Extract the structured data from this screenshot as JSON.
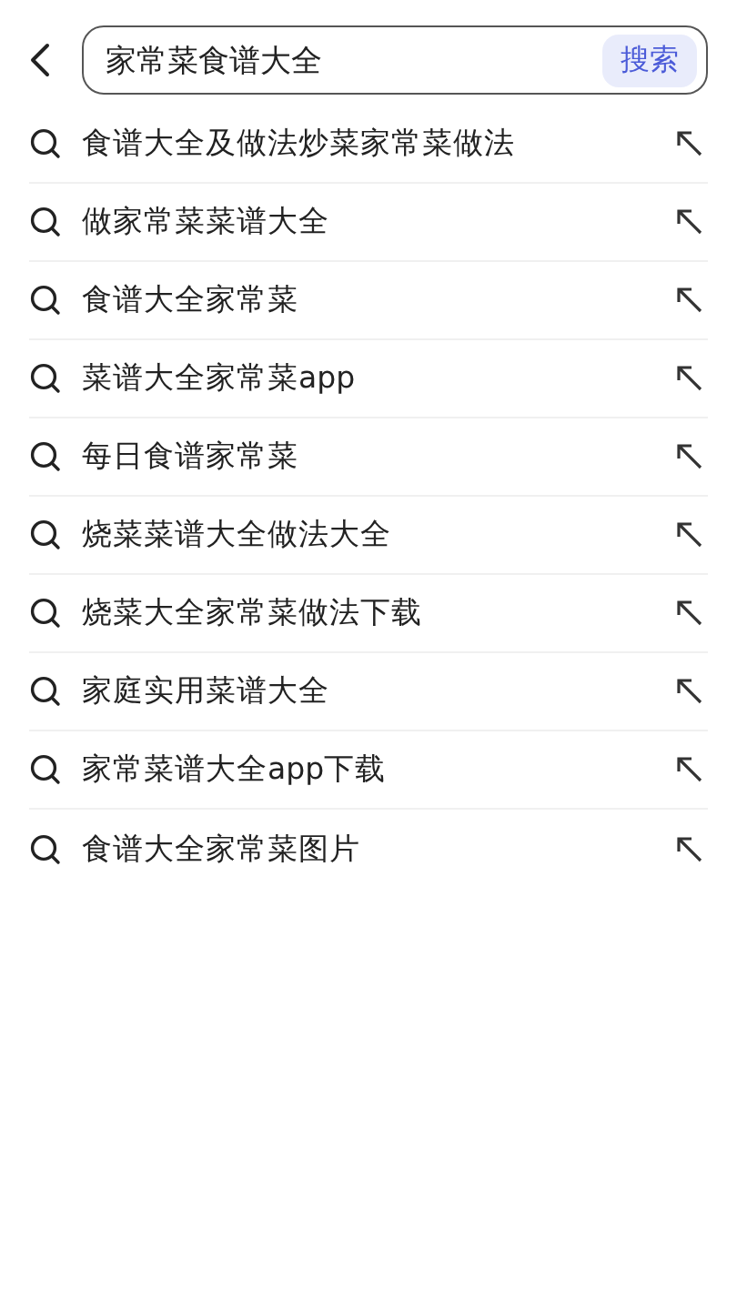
{
  "search": {
    "value": "家常菜食谱大全",
    "button": "搜索"
  },
  "suggestions": [
    {
      "text": "食谱大全及做法炒菜家常菜做法"
    },
    {
      "text": "做家常菜菜谱大全"
    },
    {
      "text": "食谱大全家常菜"
    },
    {
      "text": "菜谱大全家常菜app"
    },
    {
      "text": "每日食谱家常菜"
    },
    {
      "text": "烧菜菜谱大全做法大全"
    },
    {
      "text": "烧菜大全家常菜做法下载"
    },
    {
      "text": "家庭实用菜谱大全"
    },
    {
      "text": "家常菜谱大全app下载"
    },
    {
      "text": "食谱大全家常菜图片"
    }
  ]
}
